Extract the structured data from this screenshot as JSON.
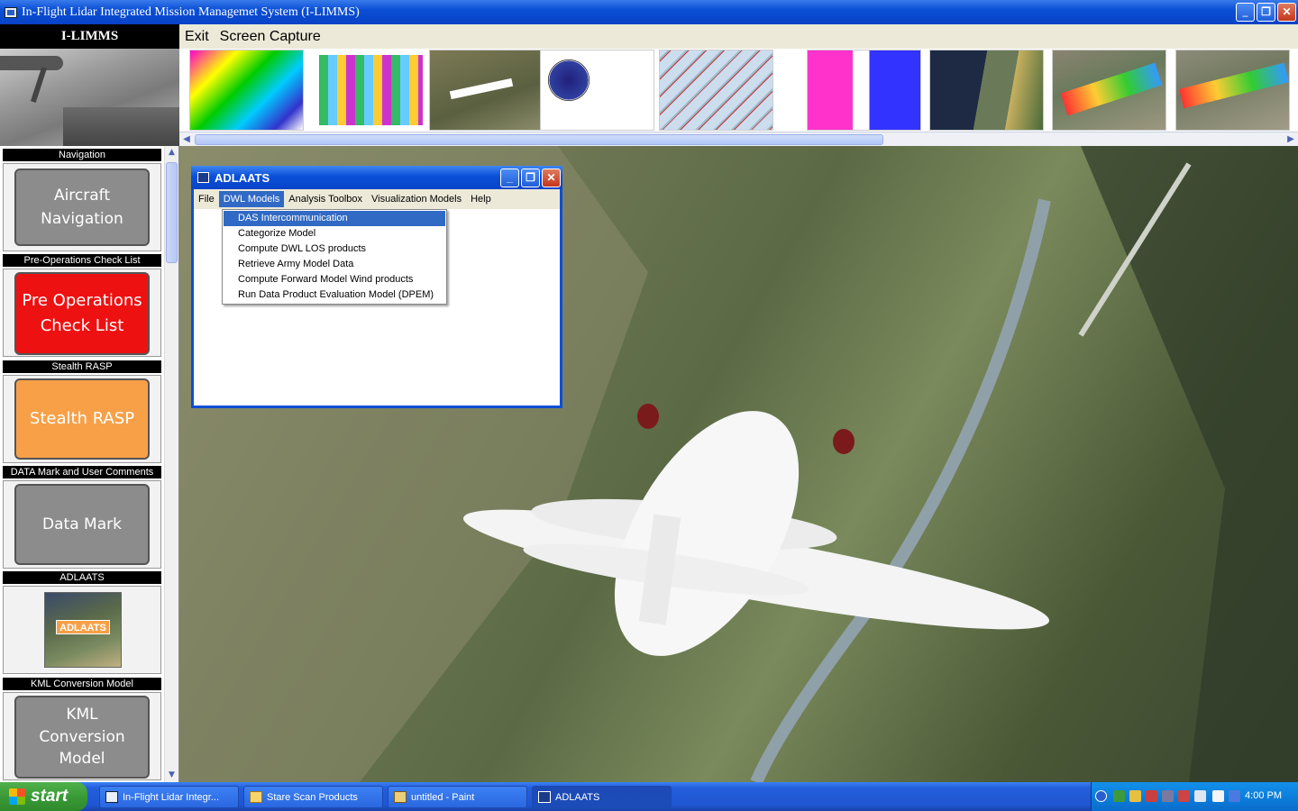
{
  "window": {
    "title": "In-Flight Lidar Integrated Mission Managemet System (I-LIMMS)",
    "controls": [
      "_",
      "❐",
      "✕"
    ]
  },
  "brand": "I-LIMMS",
  "menubar": [
    "Exit",
    "Screen Capture"
  ],
  "thumbnails": [
    "wind-profile-plot",
    "color-grid-chart",
    "aircraft-photo",
    "polar-scan-plot",
    "map-flight-tracks",
    "lidar-scan-panels",
    "3d-wind-over-lake",
    "3d-wind-curtain-1",
    "3d-wind-curtain-2"
  ],
  "sidebar": {
    "sections": [
      {
        "label": "Navigation",
        "button": "Aircraft\nNavigation",
        "style": "gray"
      },
      {
        "label": "Pre-Operations Check List",
        "button": "Pre Operations\nCheck List",
        "style": "red"
      },
      {
        "label": "Stealth RASP",
        "button": "Stealth RASP",
        "style": "orange"
      },
      {
        "label": "DATA Mark and User Comments",
        "button": "Data Mark",
        "style": "gray"
      },
      {
        "label": "ADLAATS",
        "button": "ADLAATS",
        "style": "image"
      },
      {
        "label": "KML Conversion Model",
        "button": "KML\nConversion\nModel",
        "style": "gray"
      }
    ]
  },
  "adlaats": {
    "title": "ADLAATS",
    "menu": [
      "File",
      "DWL Models",
      "Analysis Toolbox",
      "Visualization Models",
      "Help"
    ],
    "active_menu": "DWL Models",
    "dropdown": [
      "DAS Intercommunication",
      "Categorize Model",
      "Compute DWL LOS products",
      "Retrieve Army Model Data",
      "Compute Forward Model Wind products",
      "Run Data Product Evaluation Model (DPEM)"
    ],
    "selected_item": "DAS Intercommunication"
  },
  "taskbar": {
    "start": "start",
    "tasks": [
      {
        "label": "In-Flight Lidar Integr...",
        "icon": "app-icon"
      },
      {
        "label": "Stare Scan Products",
        "icon": "folder-icon"
      },
      {
        "label": "untitled - Paint",
        "icon": "paint-icon"
      },
      {
        "label": "ADLAATS",
        "icon": "adlaats-icon"
      }
    ],
    "active_task": "ADLAATS",
    "clock": "4:00 PM"
  },
  "colors": {
    "xp_blue": "#0a4fd6",
    "menu_highlight": "#316ac5",
    "button_gray": "#8c8c8c",
    "button_red": "#ee1111",
    "button_orange": "#f7a048"
  }
}
